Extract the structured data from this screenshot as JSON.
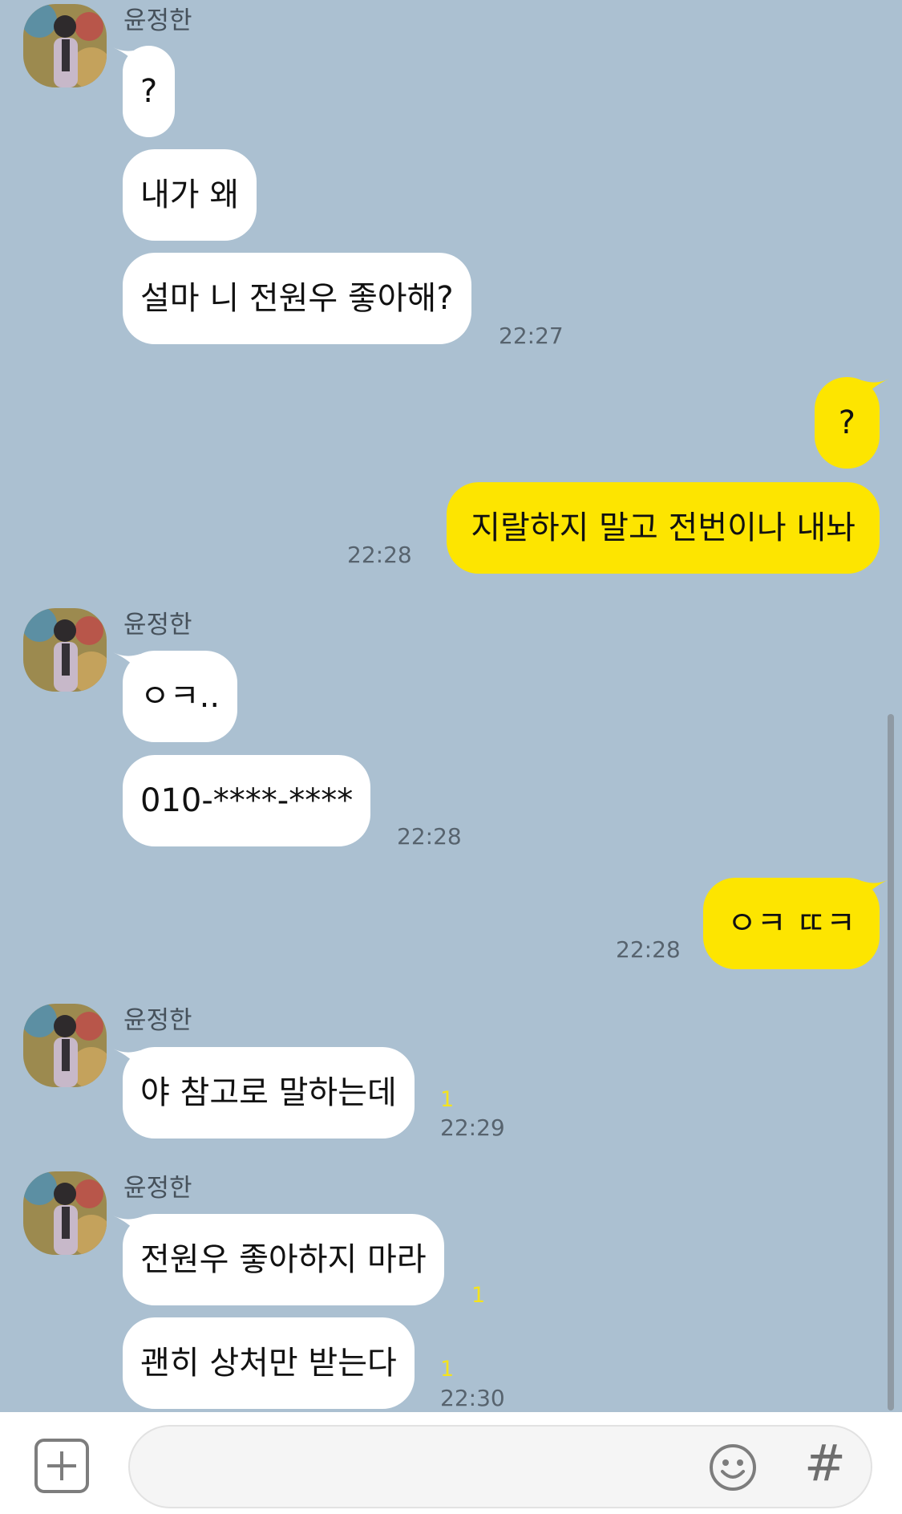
{
  "contact": {
    "name": "윤정한"
  },
  "messages": [
    {
      "text": "?"
    },
    {
      "text": "내가 왜"
    },
    {
      "text": "설마 니 전원우 좋아해?",
      "time": "22:27"
    },
    {
      "text": "?"
    },
    {
      "text": "지랄하지 말고 전번이나 내놔",
      "time": "22:28"
    },
    {
      "text": "ㅇㅋ.."
    },
    {
      "text": "010-****-****",
      "time": "22:28"
    },
    {
      "text": "ㅇㅋ ㄸㅋ",
      "time": "22:28"
    },
    {
      "text": "야 참고로 말하는데",
      "time": "22:29",
      "unread": "1"
    },
    {
      "text": "전원우 좋아하지 마라",
      "unread": "1"
    },
    {
      "text": "괜히 상처만 받는다",
      "time": "22:30",
      "unread": "1"
    }
  ],
  "colors": {
    "background": "#abc0d1",
    "incoming": "#ffffff",
    "outgoing": "#fde500",
    "unread": "#f5e31c"
  },
  "input": {
    "placeholder": "",
    "plus_icon": "plus-icon",
    "emoji_icon": "emoji-icon",
    "hash_icon": "#"
  }
}
